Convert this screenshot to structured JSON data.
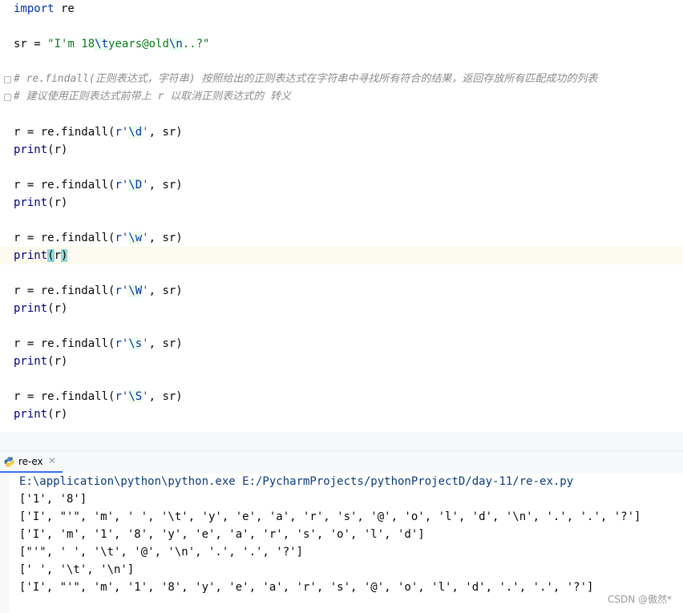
{
  "editor": {
    "l1_import": "import",
    "l1_rest": " re",
    "l2_var": "sr = ",
    "l2_str_a": "\"I'm 18",
    "l2_esc_t": "\\t",
    "l2_str_b": "years@old",
    "l2_esc_n": "\\n",
    "l2_str_c": "..?\"",
    "c1_hash": "# ",
    "c1_text": "re.findall(正则表达式，字符串) 按照给出的正则表达式在字符串中寻找所有符合的结果，返回存放所有匹配成功的列表",
    "c2_hash": "# ",
    "c2_text": "建议使用正则表达式前带上 r 以取消正则表达式的 转义",
    "assign_prefix": "r = re.findall(",
    "raw_prefix": "r'",
    "raw_suffix": "'",
    "assign_suffix": ", sr)",
    "print_kw": "print",
    "print_open": "(",
    "print_arg": "r",
    "print_close": ")",
    "patterns": [
      "\\d",
      "\\D",
      "\\w",
      "\\W",
      "\\s",
      "\\S"
    ]
  },
  "run": {
    "tab_label": "re-ex",
    "tab_close": "✕",
    "command": "E:\\application\\python\\python.exe E:/PycharmProjects/pythonProjectD/day-11/re-ex.py",
    "outputs": [
      "['1', '8']",
      "['I', \"'\", 'm', ' ', '\\t', 'y', 'e', 'a', 'r', 's', '@', 'o', 'l', 'd', '\\n', '.', '.', '?']",
      "['I', 'm', '1', '8', 'y', 'e', 'a', 'r', 's', 'o', 'l', 'd']",
      "[\"'\", ' ', '\\t', '@', '\\n', '.', '.', '?']",
      "[' ', '\\t', '\\n']",
      "['I', \"'\", 'm', '1', '8', 'y', 'e', 'a', 'r', 's', '@', 'o', 'l', 'd', '.', '.', '?']"
    ]
  },
  "watermark": "CSDN @傲然*",
  "colors": {
    "keyword": "#0033b3",
    "string": "#067d17",
    "escape": "#0037a6",
    "comment": "#8c8c8c",
    "current_line": "#fcfaed",
    "tab_underline": "#3574f0"
  },
  "icons": {
    "run_tab": "python-icon",
    "close": "close-icon"
  }
}
